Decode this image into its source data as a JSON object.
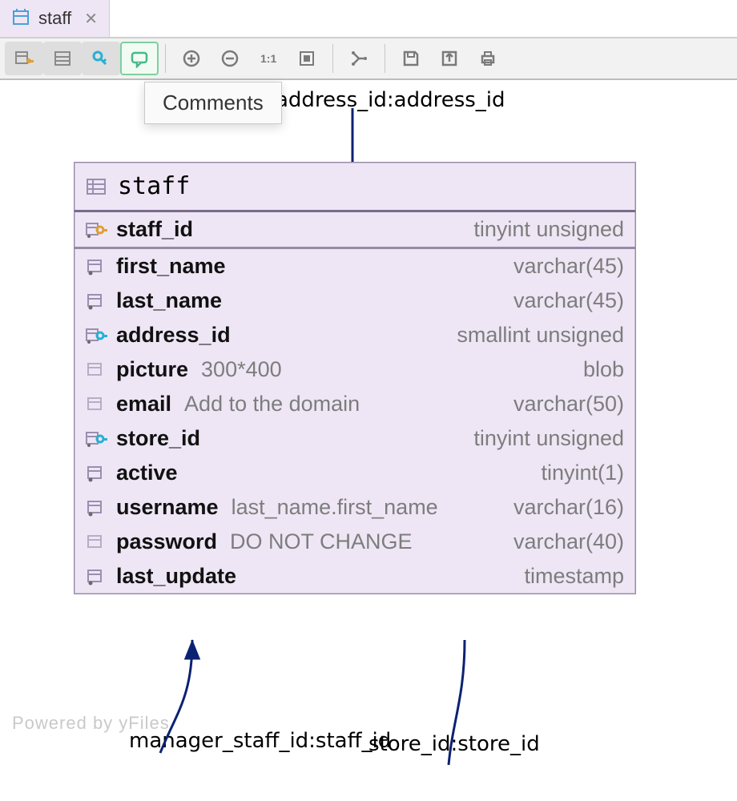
{
  "tab": {
    "label": "staff"
  },
  "tooltip": "Comments",
  "relations": {
    "top": "address_id:address_id",
    "bottom_left": "manager_staff_id:staff_id",
    "bottom_right": "store_id:store_id"
  },
  "watermark": "Powered by yFiles",
  "entity": {
    "name": "staff",
    "pk": {
      "name": "staff_id",
      "type": "tinyint unsigned"
    },
    "columns": [
      {
        "icon": "notnull",
        "name": "first_name",
        "comment": "",
        "type": "varchar(45)"
      },
      {
        "icon": "notnull",
        "name": "last_name",
        "comment": "",
        "type": "varchar(45)"
      },
      {
        "icon": "fk",
        "name": "address_id",
        "comment": "",
        "type": "smallint unsigned"
      },
      {
        "icon": "null",
        "name": "picture",
        "comment": "300*400",
        "type": "blob"
      },
      {
        "icon": "null",
        "name": "email",
        "comment": "Add to the domain",
        "type": "varchar(50)"
      },
      {
        "icon": "fk",
        "name": "store_id",
        "comment": "",
        "type": "tinyint unsigned"
      },
      {
        "icon": "notnull",
        "name": "active",
        "comment": "",
        "type": "tinyint(1)"
      },
      {
        "icon": "notnull",
        "name": "username",
        "comment": "last_name.first_name",
        "type": "varchar(16)"
      },
      {
        "icon": "null",
        "name": "password",
        "comment": "DO NOT CHANGE",
        "type": "varchar(40)"
      },
      {
        "icon": "notnull",
        "name": "last_update",
        "comment": "",
        "type": "timestamp"
      }
    ]
  }
}
